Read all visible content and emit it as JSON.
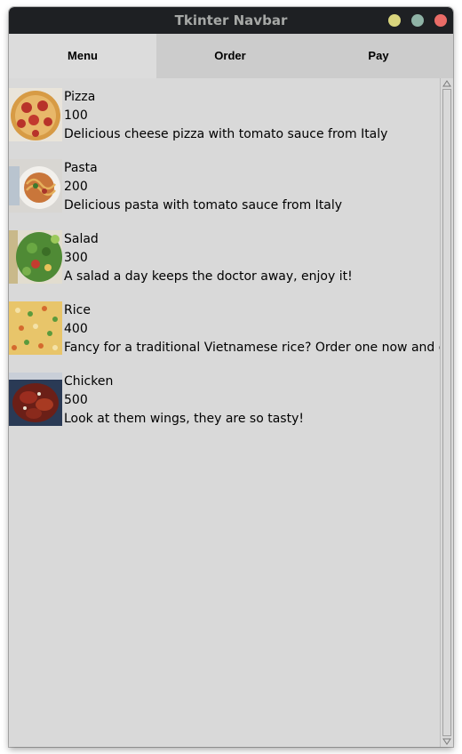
{
  "window": {
    "title": "Tkinter Navbar"
  },
  "navbar": {
    "tabs": [
      "Menu",
      "Order",
      "Pay"
    ],
    "active": "Menu"
  },
  "menu": {
    "items": [
      {
        "name": "Pizza",
        "price": "100",
        "description": "Delicious cheese pizza with tomato sauce from Italy",
        "icon": "pizza-image"
      },
      {
        "name": "Pasta",
        "price": "200",
        "description": "Delicious pasta with tomato sauce from Italy",
        "icon": "pasta-image"
      },
      {
        "name": "Salad",
        "price": "300",
        "description": "A salad a day keeps the doctor away, enjoy it!",
        "icon": "salad-image"
      },
      {
        "name": "Rice",
        "price": "400",
        "description": "Fancy for a traditional Vietnamese rice? Order one now and enjoy",
        "icon": "rice-image"
      },
      {
        "name": "Chicken",
        "price": "500",
        "description": "Look at them wings, they are so tasty!",
        "icon": "chicken-image"
      }
    ]
  },
  "colors": {
    "titlebar": "#1e2023",
    "window_bg": "#d9d9d9",
    "navbar_bg": "#cccccc",
    "active_tab_bg": "#dcdcdc",
    "minimize": "#d9d57d",
    "maximize": "#8fb3a6",
    "close": "#ea6c67"
  }
}
